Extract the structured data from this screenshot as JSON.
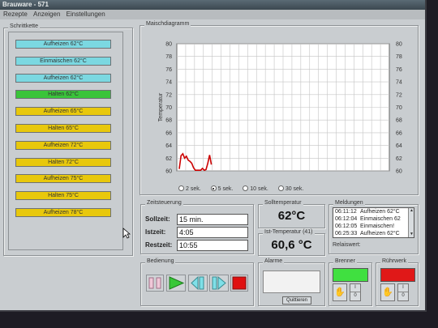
{
  "window": {
    "title": "Brauware - 571"
  },
  "menu": [
    "Rezepte",
    "Anzeigen",
    "Einstellungen"
  ],
  "schrittkette": {
    "label": "Schrittkette",
    "steps": [
      {
        "label": "Aufheizen 62°C",
        "state": "cyan"
      },
      {
        "label": "Einmaischen 62°C",
        "state": "cyan"
      },
      {
        "label": "Aufheizen 62°C",
        "state": "cyan"
      },
      {
        "label": "Halten 62°C",
        "state": "green"
      },
      {
        "label": "Aufheizen 65°C",
        "state": "yellow"
      },
      {
        "label": "Halten 65°C",
        "state": "yellow"
      },
      {
        "label": "Aufheizen 72°C",
        "state": "yellow"
      },
      {
        "label": "Halten 72°C",
        "state": "yellow"
      },
      {
        "label": "Aufheizen 75°C",
        "state": "yellow"
      },
      {
        "label": "Halten 75°C",
        "state": "yellow"
      },
      {
        "label": "Aufheizen 78°C",
        "state": "yellow"
      }
    ],
    "colors": {
      "cyan": "#7bd8e1",
      "green": "#3ac43a",
      "yellow": "#e8c80c"
    }
  },
  "maischdiagramm": {
    "label": "Maischdiagramm",
    "radios": [
      {
        "label": "2 sek.",
        "selected": false
      },
      {
        "label": "5 sek.",
        "selected": true
      },
      {
        "label": "10 sek.",
        "selected": false
      },
      {
        "label": "30 sek.",
        "selected": false
      }
    ]
  },
  "chart_data": {
    "type": "line",
    "ylabel": "Temperatur",
    "ylim": [
      60,
      80
    ],
    "yticks": [
      60,
      62,
      64,
      66,
      68,
      70,
      72,
      74,
      76,
      78,
      80
    ],
    "grid": true,
    "series": [
      {
        "color": "#cc0000",
        "x": [
          0,
          1,
          2,
          3,
          4,
          5,
          6,
          7,
          8,
          9,
          10,
          11,
          12,
          13,
          14,
          15,
          16,
          17,
          18
        ],
        "values": [
          60.3,
          62.4,
          62.7,
          62.0,
          62.3,
          61.7,
          61.5,
          61.2,
          60.5,
          60.1,
          60.1,
          60.1,
          60.1,
          60.4,
          60.1,
          60.2,
          61.2,
          62.5,
          61.0
        ]
      }
    ]
  },
  "zeitsteuerung": {
    "label": "Zeitsteuerung",
    "sollzeit_label": "Sollzeit:",
    "sollzeit": "15 min.",
    "istzeit_label": "Istzeit:",
    "istzeit": "4:05",
    "restzeit_label": "Restzeit:",
    "restzeit": "10:55"
  },
  "solltemperatur": {
    "label": "Solltemperatur",
    "value": "62°C"
  },
  "isttemperatur": {
    "label": "Ist-Temperatur (41)",
    "value": "60,6 °C"
  },
  "meldungen": {
    "label": "Meldungen",
    "rows": [
      {
        "time": "06:11:12",
        "text": "Aufheizen 62°C"
      },
      {
        "time": "06:12:04",
        "text": "Einmaischen 62"
      },
      {
        "time": "06:12:05",
        "text": "Einmaischen!"
      },
      {
        "time": "06:25:33",
        "text": "Aufheizen 62°C"
      }
    ],
    "relaiswert_label": "Relaiswert:"
  },
  "bedienung": {
    "label": "Bedienung"
  },
  "alarme": {
    "label": "Alarme",
    "quit_label": "Quittieren"
  },
  "brenner": {
    "label": "Brenner",
    "lamp_color": "#40e040",
    "on": "I",
    "off": "0"
  },
  "ruhrwerk": {
    "label": "Rührwerk",
    "lamp_color": "#e01818",
    "on": "I",
    "off": "0"
  }
}
